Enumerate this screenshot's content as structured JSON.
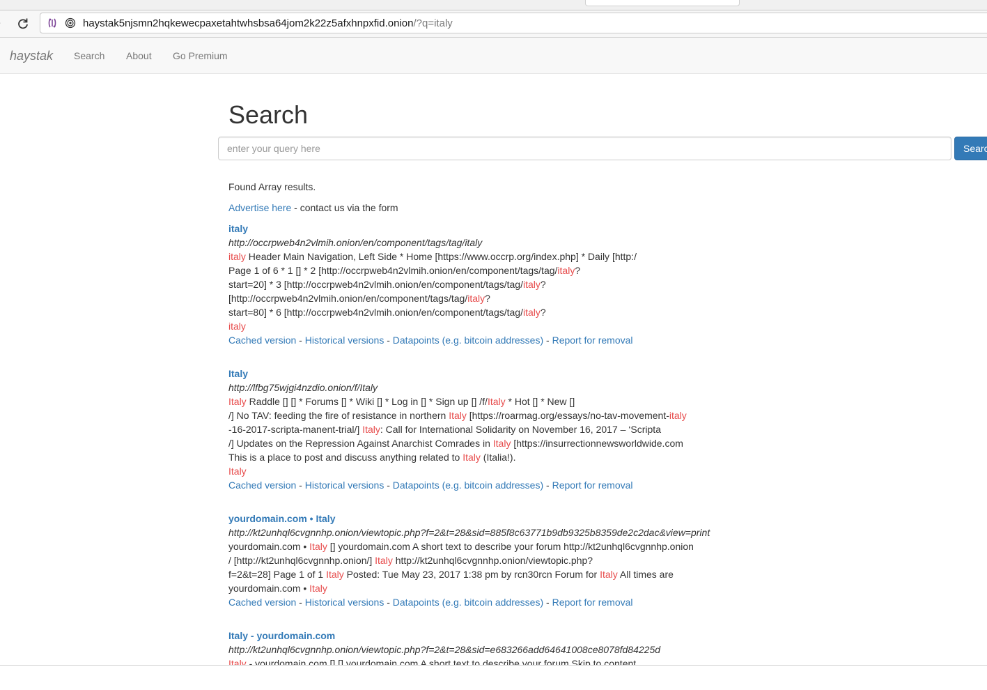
{
  "browser": {
    "url_host": "haystak5njsmn2hqkewecpaxetahtwhsbsa64jom2k22z5afxhnpxfid.onion",
    "url_query": "/?q=italy"
  },
  "navbar": {
    "brand": "haystak",
    "links": [
      "Search",
      "About",
      "Go Premium"
    ]
  },
  "search": {
    "heading": "Search",
    "placeholder": "enter your query here",
    "button_label": "Search"
  },
  "summary": {
    "found_text": "Found Array results.",
    "advertise_link": "Advertise here",
    "advertise_rest": " - contact us via the form"
  },
  "result_links": {
    "cached": "Cached version",
    "historical": "Historical versions",
    "datapoints": "Datapoints (e.g. bitcoin addresses)",
    "report": "Report for removal",
    "separator": " - "
  },
  "results": [
    {
      "title": "italy",
      "url": "http://occrpweb4n2vlmih.onion/en/component/tags/tag/italy",
      "snippet": [
        {
          "t": "italy",
          "h": true
        },
        {
          "t": " Header Main Navigation, Left Side * Home [https://www.occrp.org/index.php] * Daily [http:/\nPage 1 of 6 * 1 [] * 2 [http://occrpweb4n2vlmih.onion/en/component/tags/tag/"
        },
        {
          "t": "italy",
          "h": true
        },
        {
          "t": "?\nstart=20] * 3 [http://occrpweb4n2vlmih.onion/en/component/tags/tag/"
        },
        {
          "t": "italy",
          "h": true
        },
        {
          "t": "?\n[http://occrpweb4n2vlmih.onion/en/component/tags/tag/"
        },
        {
          "t": "italy",
          "h": true
        },
        {
          "t": "?\nstart=80] * 6 [http://occrpweb4n2vlmih.onion/en/component/tags/tag/"
        },
        {
          "t": "italy",
          "h": true
        },
        {
          "t": "?\n"
        },
        {
          "t": "italy",
          "h": true
        }
      ]
    },
    {
      "title": "Italy",
      "url": "http://lfbg75wjgi4nzdio.onion/f/Italy",
      "snippet": [
        {
          "t": "Italy",
          "h": true
        },
        {
          "t": " Raddle [] [] * Forums [] * Wiki [] * Log in [] * Sign up [] /f/"
        },
        {
          "t": "Italy",
          "h": true
        },
        {
          "t": " * Hot [] * New []\n/] No TAV: feeding the fire of resistance in northern "
        },
        {
          "t": "Italy",
          "h": true
        },
        {
          "t": " [https://roarmag.org/essays/no-tav-movement-"
        },
        {
          "t": "italy",
          "h": true
        },
        {
          "t": "\n-16-2017-scripta-manent-trial/] "
        },
        {
          "t": "Italy",
          "h": true
        },
        {
          "t": ": Call for International Solidarity on November 16, 2017 – ‘Scripta\n/] Updates on the Repression Against Anarchist Comrades in "
        },
        {
          "t": "Italy",
          "h": true
        },
        {
          "t": " [https://insurrectionnewsworldwide.com\nThis is a place to post and discuss anything related to "
        },
        {
          "t": "Italy",
          "h": true
        },
        {
          "t": " (Italia!).\n"
        },
        {
          "t": "Italy",
          "h": true
        }
      ]
    },
    {
      "title": "yourdomain.com • Italy",
      "url": "http://kt2unhql6cvgnnhp.onion/viewtopic.php?f=2&t=28&sid=885f8c63771b9db9325b8359de2c2dac&view=print",
      "snippet": [
        {
          "t": "yourdomain.com • "
        },
        {
          "t": "Italy",
          "h": true
        },
        {
          "t": " [] yourdomain.com A short text to describe your forum http://kt2unhql6cvgnnhp.onion\n/ [http://kt2unhql6cvgnnhp.onion/] "
        },
        {
          "t": "Italy",
          "h": true
        },
        {
          "t": " http://kt2unhql6cvgnnhp.onion/viewtopic.php?\nf=2&t=28] Page 1 of 1 "
        },
        {
          "t": "Italy",
          "h": true
        },
        {
          "t": " Posted: Tue May 23, 2017 1:38 pm by rcn30rcn Forum for "
        },
        {
          "t": "Italy",
          "h": true
        },
        {
          "t": " All times are\nyourdomain.com • "
        },
        {
          "t": "Italy",
          "h": true
        }
      ]
    },
    {
      "title": "Italy - yourdomain.com",
      "url": "http://kt2unhql6cvgnnhp.onion/viewtopic.php?f=2&t=28&sid=e683266add64641008ce8078fd84225d",
      "snippet": [
        {
          "t": "Italy",
          "h": true
        },
        {
          "t": " - yourdomain.com [] [] yourdomain.com A short text to describe your forum Skip to content"
        }
      ]
    }
  ],
  "colors": {
    "link": "#337ab7",
    "highlight": "#e74c4c",
    "button": "#337ab7",
    "navbar_bg": "#f8f8f8"
  }
}
